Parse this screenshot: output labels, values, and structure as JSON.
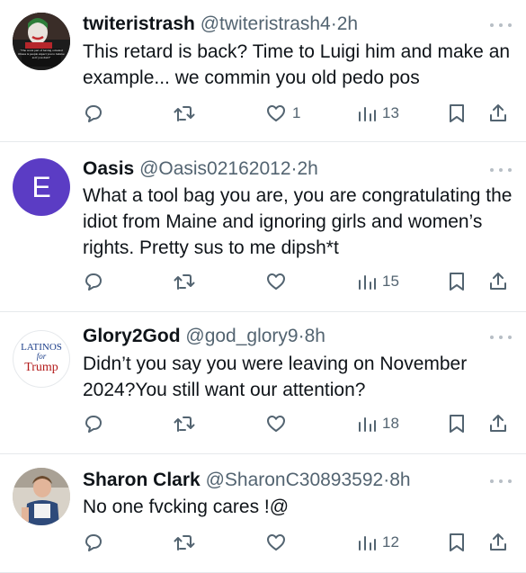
{
  "tweets": [
    {
      "name": "twiteristrash",
      "handle": "@twiteristrash4",
      "time": "2h",
      "text": "This retard is back? Time to Luigi him and make an example... we commin you old pedo pos",
      "likes": "1",
      "views": "13",
      "avatar": {
        "type": "image",
        "caption": "\"The worst part of having a mental illness is people expect you to behave as if you don't\""
      }
    },
    {
      "name": "Oasis",
      "handle": "@Oasis02162012",
      "time": "2h",
      "text": "What a tool bag you are, you are congratulating the idiot from Maine and ignoring girls and women’s rights. Pretty sus to me dipsh*t",
      "likes": "",
      "views": "15",
      "avatar": {
        "type": "letter",
        "letter": "E",
        "color": "#5b3cc4"
      }
    },
    {
      "name": "Glory2God",
      "handle": "@god_glory9",
      "time": "8h",
      "text": "Didn’t you say you were leaving on November 2024?You still want our attention?",
      "likes": "",
      "views": "18",
      "avatar": {
        "type": "logo",
        "line1": "LATINOS",
        "line2": "for",
        "line3": "Trump"
      }
    },
    {
      "name": "Sharon Clark",
      "handle": "@SharonC30893592",
      "time": "8h",
      "text": "No one fvcking cares !@",
      "likes": "",
      "views": "12",
      "avatar": {
        "type": "photo"
      }
    }
  ],
  "colors": {
    "meta": "#536471",
    "divider": "#e6e9ec",
    "text": "#0f1419"
  },
  "icons": [
    "reply-icon",
    "retweet-icon",
    "like-icon",
    "views-icon",
    "bookmark-icon",
    "share-icon",
    "more-icon"
  ]
}
